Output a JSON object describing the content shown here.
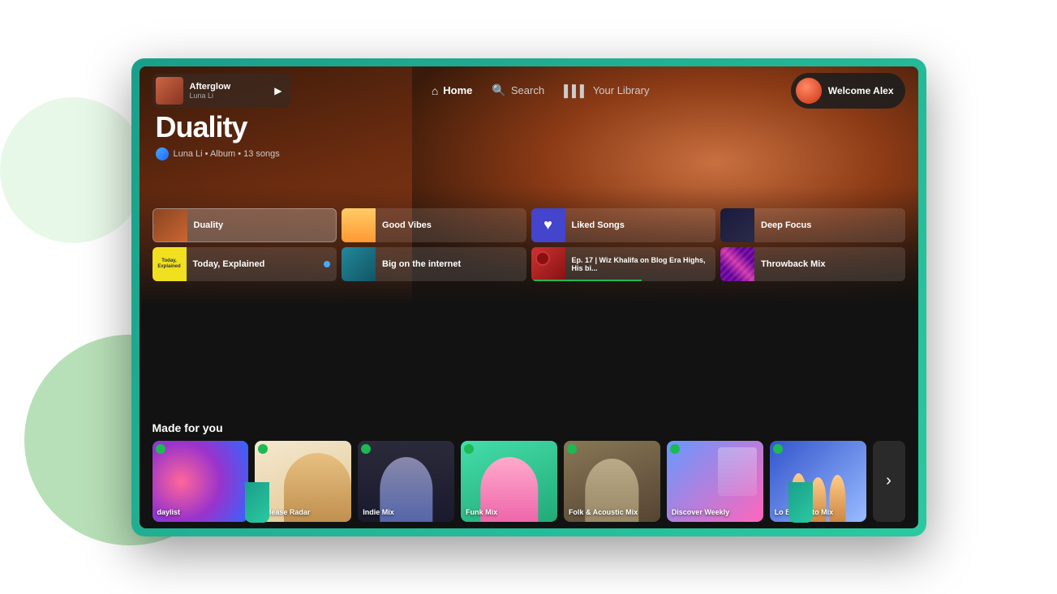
{
  "page": {
    "bg_color": "#ffffff"
  },
  "now_playing": {
    "title": "Afterglow",
    "artist": "Luna Li",
    "play_icon": "▶"
  },
  "nav": {
    "home_label": "Home",
    "search_label": "Search",
    "library_label": "Your Library"
  },
  "user": {
    "welcome": "Welcome Alex"
  },
  "hero": {
    "album_title": "Duality",
    "artist_name": "Luna Li",
    "type": "Album",
    "song_count": "13 songs"
  },
  "quick_items": [
    {
      "id": "duality",
      "label": "Duality",
      "active": true
    },
    {
      "id": "good-vibes",
      "label": "Good Vibes",
      "active": false
    },
    {
      "id": "liked-songs",
      "label": "Liked Songs",
      "active": false
    },
    {
      "id": "deep-focus",
      "label": "Deep Focus",
      "active": false
    },
    {
      "id": "today-explained",
      "label": "Today, Explained",
      "active": false,
      "has_dot": true
    },
    {
      "id": "big-internet",
      "label": "Big on the internet",
      "active": false
    },
    {
      "id": "wiz-khalifa",
      "label": "Ep. 17 | Wiz Khalifa on Blog Era Highs, His bi...",
      "active": false
    },
    {
      "id": "throwback-mix",
      "label": "Throwback Mix",
      "active": false
    }
  ],
  "made_for_you": {
    "section_title": "Made for you",
    "cards": [
      {
        "id": "daylist",
        "label": "daylist"
      },
      {
        "id": "release-radar",
        "label": "Release Radar"
      },
      {
        "id": "indie-mix",
        "label": "Indie Mix"
      },
      {
        "id": "funk-mix",
        "label": "Funk Mix"
      },
      {
        "id": "folk-acoustic",
        "label": "Folk & Acoustic Mix"
      },
      {
        "id": "discover-weekly",
        "label": "Discover Weekly"
      },
      {
        "id": "lo-blanquito",
        "label": "Lo Blanquito Mix"
      },
      {
        "id": "more",
        "label": ""
      }
    ]
  }
}
